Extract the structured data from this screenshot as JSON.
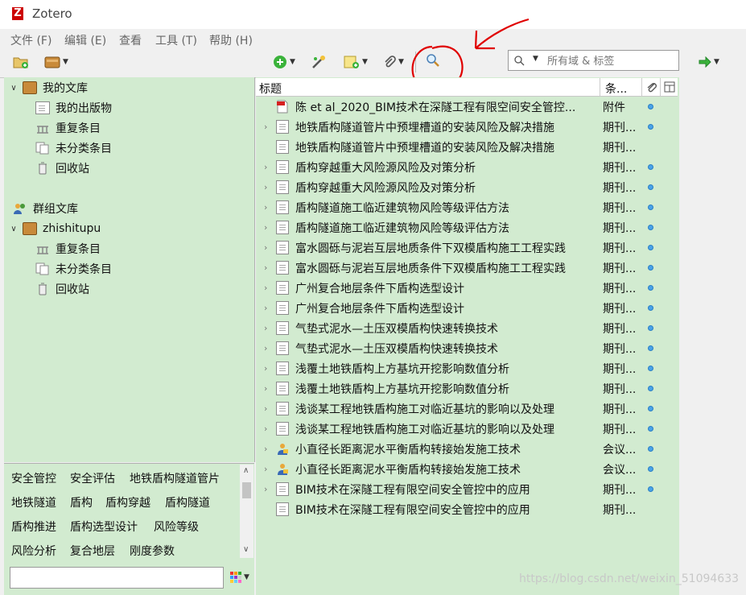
{
  "window": {
    "title": "Zotero",
    "logo": "Z"
  },
  "menu": [
    "文件 (F)",
    "编辑 (E)",
    "查看",
    "工具 (T)",
    "帮助 (H)"
  ],
  "toolbar": {
    "icons": [
      "new-collection-icon",
      "new-library-icon",
      "new-item-icon",
      "magic-wand-icon",
      "new-note-icon",
      "attachment-icon",
      "search-icon",
      "go-forward-icon"
    ],
    "search_placeholder": "所有域 & 标签"
  },
  "library": {
    "my_library": "我的文库",
    "my_items": [
      "我的出版物",
      "重复条目",
      "未分类条目",
      "回收站"
    ],
    "group_libraries": "群组文库",
    "group_name": "zhishitupu",
    "group_items": [
      "重复条目",
      "未分类条目",
      "回收站"
    ]
  },
  "tags": [
    [
      "安全管控",
      "安全评估",
      "地铁盾构隧道管片"
    ],
    [
      "地铁隧道",
      "盾构",
      "盾构穿越",
      "盾构隧道"
    ],
    [
      "盾构推进",
      "盾构选型设计",
      "风险等级"
    ],
    [
      "风险分析",
      "复合地层",
      "刚度参数"
    ]
  ],
  "columns": {
    "title": "标题",
    "type": "条..."
  },
  "items": [
    {
      "title": "陈 et al_2020_BIM技术在深隧工程有限空间安全管控...",
      "type": "附件",
      "icon": "pdf",
      "twisty": false,
      "dot": true
    },
    {
      "title": "地铁盾构隧道管片中预埋槽道的安装风险及解决措施",
      "type": "期刊...",
      "icon": "doc",
      "twisty": true,
      "dot": true
    },
    {
      "title": "地铁盾构隧道管片中预埋槽道的安装风险及解决措施",
      "type": "期刊...",
      "icon": "doc",
      "twisty": false,
      "dot": false
    },
    {
      "title": "盾构穿越重大风险源风险及对策分析",
      "type": "期刊...",
      "icon": "doc",
      "twisty": true,
      "dot": true
    },
    {
      "title": "盾构穿越重大风险源风险及对策分析",
      "type": "期刊...",
      "icon": "doc",
      "twisty": true,
      "dot": true
    },
    {
      "title": "盾构隧道施工临近建筑物风险等级评估方法",
      "type": "期刊...",
      "icon": "doc",
      "twisty": true,
      "dot": true
    },
    {
      "title": "盾构隧道施工临近建筑物风险等级评估方法",
      "type": "期刊...",
      "icon": "doc",
      "twisty": true,
      "dot": true
    },
    {
      "title": "富水圆砾与泥岩互层地质条件下双模盾构施工工程实践",
      "type": "期刊...",
      "icon": "doc",
      "twisty": true,
      "dot": true
    },
    {
      "title": "富水圆砾与泥岩互层地质条件下双模盾构施工工程实践",
      "type": "期刊...",
      "icon": "doc",
      "twisty": true,
      "dot": true
    },
    {
      "title": "广州复合地层条件下盾构选型设计",
      "type": "期刊...",
      "icon": "doc",
      "twisty": true,
      "dot": true
    },
    {
      "title": "广州复合地层条件下盾构选型设计",
      "type": "期刊...",
      "icon": "doc",
      "twisty": true,
      "dot": true
    },
    {
      "title": "气垫式泥水—土压双模盾构快速转换技术",
      "type": "期刊...",
      "icon": "doc",
      "twisty": true,
      "dot": true
    },
    {
      "title": "气垫式泥水—土压双模盾构快速转换技术",
      "type": "期刊...",
      "icon": "doc",
      "twisty": true,
      "dot": true
    },
    {
      "title": "浅覆土地铁盾构上方基坑开挖影响数值分析",
      "type": "期刊...",
      "icon": "doc",
      "twisty": true,
      "dot": true
    },
    {
      "title": "浅覆土地铁盾构上方基坑开挖影响数值分析",
      "type": "期刊...",
      "icon": "doc",
      "twisty": true,
      "dot": true
    },
    {
      "title": "浅谈某工程地铁盾构施工对临近基坑的影响以及处理",
      "type": "期刊...",
      "icon": "doc",
      "twisty": true,
      "dot": true
    },
    {
      "title": "浅谈某工程地铁盾构施工对临近基坑的影响以及处理",
      "type": "期刊...",
      "icon": "doc",
      "twisty": true,
      "dot": true
    },
    {
      "title": "小直径长距离泥水平衡盾构转接始发施工技术",
      "type": "会议...",
      "icon": "conf",
      "twisty": true,
      "dot": true
    },
    {
      "title": "小直径长距离泥水平衡盾构转接始发施工技术",
      "type": "会议...",
      "icon": "conf",
      "twisty": true,
      "dot": true
    },
    {
      "title": "BIM技术在深隧工程有限空间安全管控中的应用",
      "type": "期刊...",
      "icon": "doc",
      "twisty": true,
      "dot": true
    },
    {
      "title": "BIM技术在深隧工程有限空间安全管控中的应用",
      "type": "期刊...",
      "icon": "doc",
      "twisty": false,
      "dot": false
    }
  ],
  "watermark": "https://blog.csdn.net/weixin_51094633",
  "colors": {
    "pane_bg": "#d2ebd0",
    "annotation": "#e00000",
    "dot": "#4aa3e8"
  }
}
